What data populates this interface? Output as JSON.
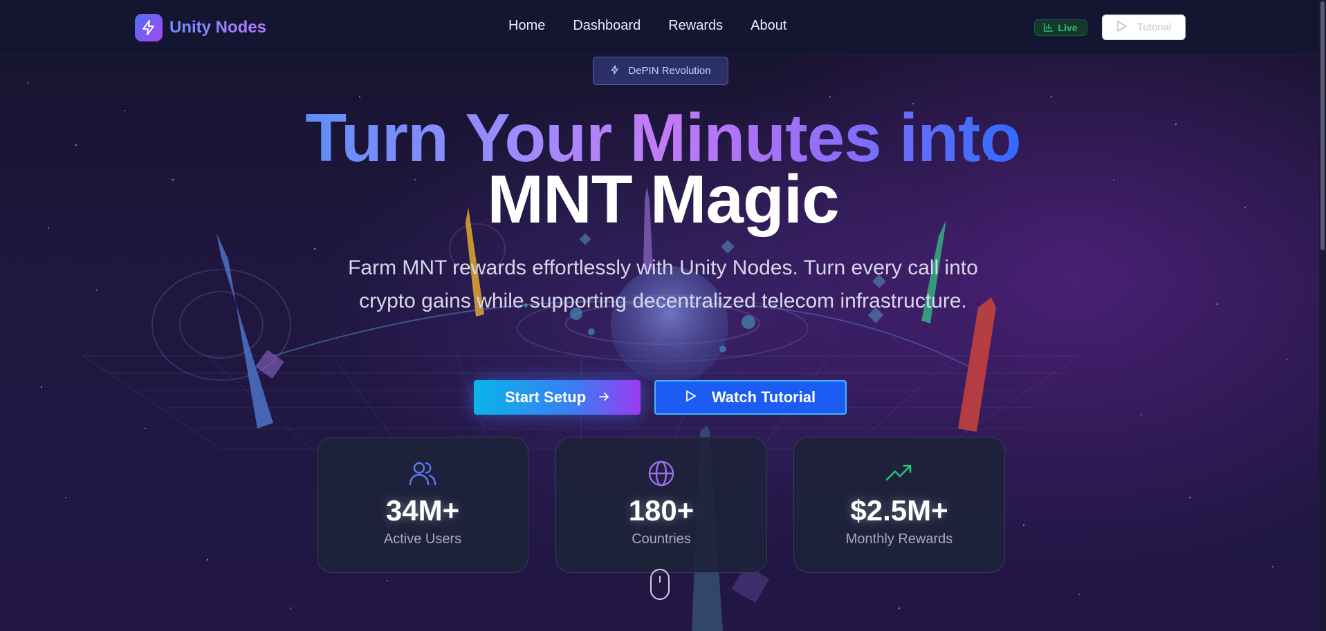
{
  "header": {
    "brand": "Unity Nodes",
    "nav": [
      "Home",
      "Dashboard",
      "Rewards",
      "About"
    ],
    "live_label": "Live",
    "tutorial_label": "Tutorial"
  },
  "hero": {
    "badge": "DePIN Revolution",
    "title_line1": "Turn Your Minutes into",
    "title_line2": "MNT Magic",
    "subtitle": "Farm MNT rewards effortlessly with Unity Nodes. Turn every call into crypto gains while supporting decentralized telecom infrastructure.",
    "start_label": "Start Setup",
    "watch_label": "Watch Tutorial"
  },
  "stats": [
    {
      "icon": "users-icon",
      "value": "34M+",
      "label": "Active Users",
      "color": "#5b7bf5"
    },
    {
      "icon": "globe-icon",
      "value": "180+",
      "label": "Countries",
      "color": "#9a6ff2"
    },
    {
      "icon": "trending-up-icon",
      "value": "$2.5M+",
      "label": "Monthly Rewards",
      "color": "#27c374"
    }
  ],
  "colors": {
    "accent_blue": "#1d5cf2",
    "accent_purple": "#9b3bf2",
    "live_green": "#29c27a",
    "background": "#17132e"
  }
}
